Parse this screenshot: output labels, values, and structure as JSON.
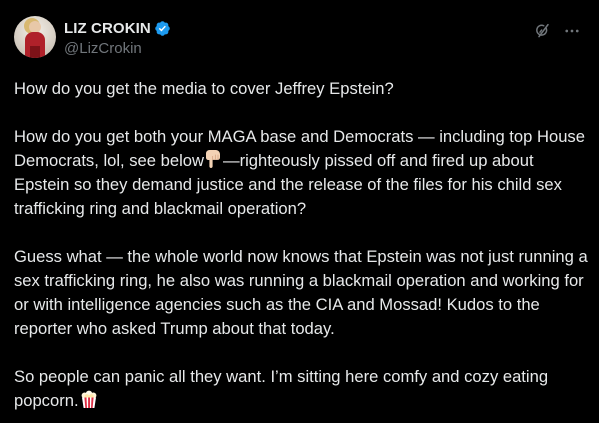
{
  "author": {
    "display_name": "LIZ CROKIN",
    "handle": "@LizCrokin",
    "verified": true,
    "verified_color": "#1d9bf0"
  },
  "icons": {
    "grok": "grok-icon",
    "more": "more-options-icon",
    "pointing_down": "backhand-index-pointing-down-emoji",
    "popcorn": "popcorn-emoji"
  },
  "tweet": {
    "p1": "How do you get the media to cover Jeffrey Epstein?",
    "p2_before": "How do you get both your MAGA base and Democrats — including top House Democrats, lol, see below",
    "p2_after": "—righteously pissed off and fired up about Epstein so they demand justice and the release of the files for his child sex trafficking ring and blackmail operation?",
    "p3": "Guess what — the whole world now knows that Epstein was not just running a sex trafficking ring, he also was running a blackmail operation and working for or with intelligence agencies such as the CIA and Mossad! Kudos to the reporter who asked Trump about that today.",
    "p4": "So people can panic all they want. I’m sitting here comfy and cozy eating popcorn."
  },
  "colors": {
    "background": "#000000",
    "text": "#e7e9ea",
    "secondary_text": "#71767b"
  }
}
